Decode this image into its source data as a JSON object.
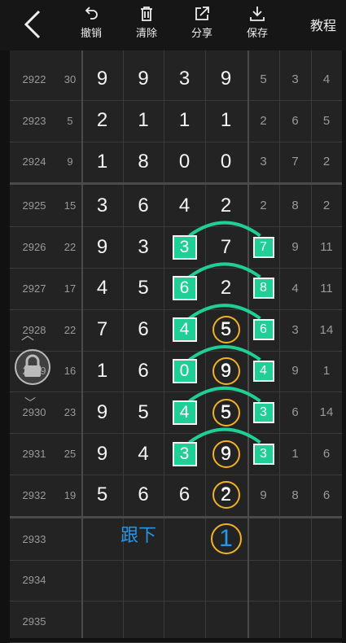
{
  "toolbar": {
    "undo_label": "撤销",
    "clear_label": "清除",
    "share_label": "分享",
    "save_label": "保存",
    "tutorial_label": "教程"
  },
  "rows": [
    {
      "period": "2922",
      "sum": "30",
      "main": [
        "9",
        "9",
        "3",
        "9"
      ],
      "tail": [
        "5",
        "3",
        "4"
      ]
    },
    {
      "period": "2923",
      "sum": "5",
      "main": [
        "2",
        "1",
        "1",
        "1"
      ],
      "tail": [
        "2",
        "6",
        "5"
      ]
    },
    {
      "period": "2924",
      "sum": "9",
      "main": [
        "1",
        "8",
        "0",
        "0"
      ],
      "tail": [
        "3",
        "7",
        "2"
      ]
    },
    {
      "period": "2925",
      "sum": "15",
      "main": [
        "3",
        "6",
        "4",
        "2"
      ],
      "tail": [
        "2",
        "8",
        "2"
      ]
    },
    {
      "period": "2926",
      "sum": "22",
      "main": [
        "9",
        "3",
        "3",
        "7"
      ],
      "tail": [
        "7",
        "9",
        "11"
      ]
    },
    {
      "period": "2927",
      "sum": "17",
      "main": [
        "4",
        "5",
        "6",
        "2"
      ],
      "tail": [
        "8",
        "4",
        "11"
      ]
    },
    {
      "period": "2928",
      "sum": "22",
      "main": [
        "7",
        "6",
        "4",
        "5"
      ],
      "tail": [
        "6",
        "3",
        "14"
      ]
    },
    {
      "period": "2929",
      "sum": "16",
      "main": [
        "1",
        "6",
        "0",
        "9"
      ],
      "tail": [
        "4",
        "9",
        "1"
      ]
    },
    {
      "period": "2930",
      "sum": "23",
      "main": [
        "9",
        "5",
        "4",
        "5"
      ],
      "tail": [
        "3",
        "6",
        "14"
      ]
    },
    {
      "period": "2931",
      "sum": "25",
      "main": [
        "9",
        "4",
        "3",
        "9"
      ],
      "tail": [
        "3",
        "1",
        "6"
      ]
    },
    {
      "period": "2932",
      "sum": "19",
      "main": [
        "5",
        "6",
        "6",
        "2"
      ],
      "tail": [
        "9",
        "8",
        "6"
      ]
    },
    {
      "period": "2933",
      "sum": "",
      "main": [
        "",
        "",
        "",
        ""
      ],
      "tail": [
        "",
        "",
        ""
      ]
    },
    {
      "period": "2934",
      "sum": "",
      "main": [
        "",
        "",
        "",
        ""
      ],
      "tail": [
        "",
        "",
        ""
      ]
    },
    {
      "period": "2935",
      "sum": "",
      "main": [
        "",
        "",
        "",
        ""
      ],
      "tail": [
        "",
        "",
        ""
      ]
    }
  ],
  "annotation": {
    "follow_text": "跟下",
    "prediction": "1"
  },
  "colors": {
    "accent_green": "#1fcf95",
    "circle_orange": "#f2b224",
    "note_blue": "#2596e8"
  }
}
